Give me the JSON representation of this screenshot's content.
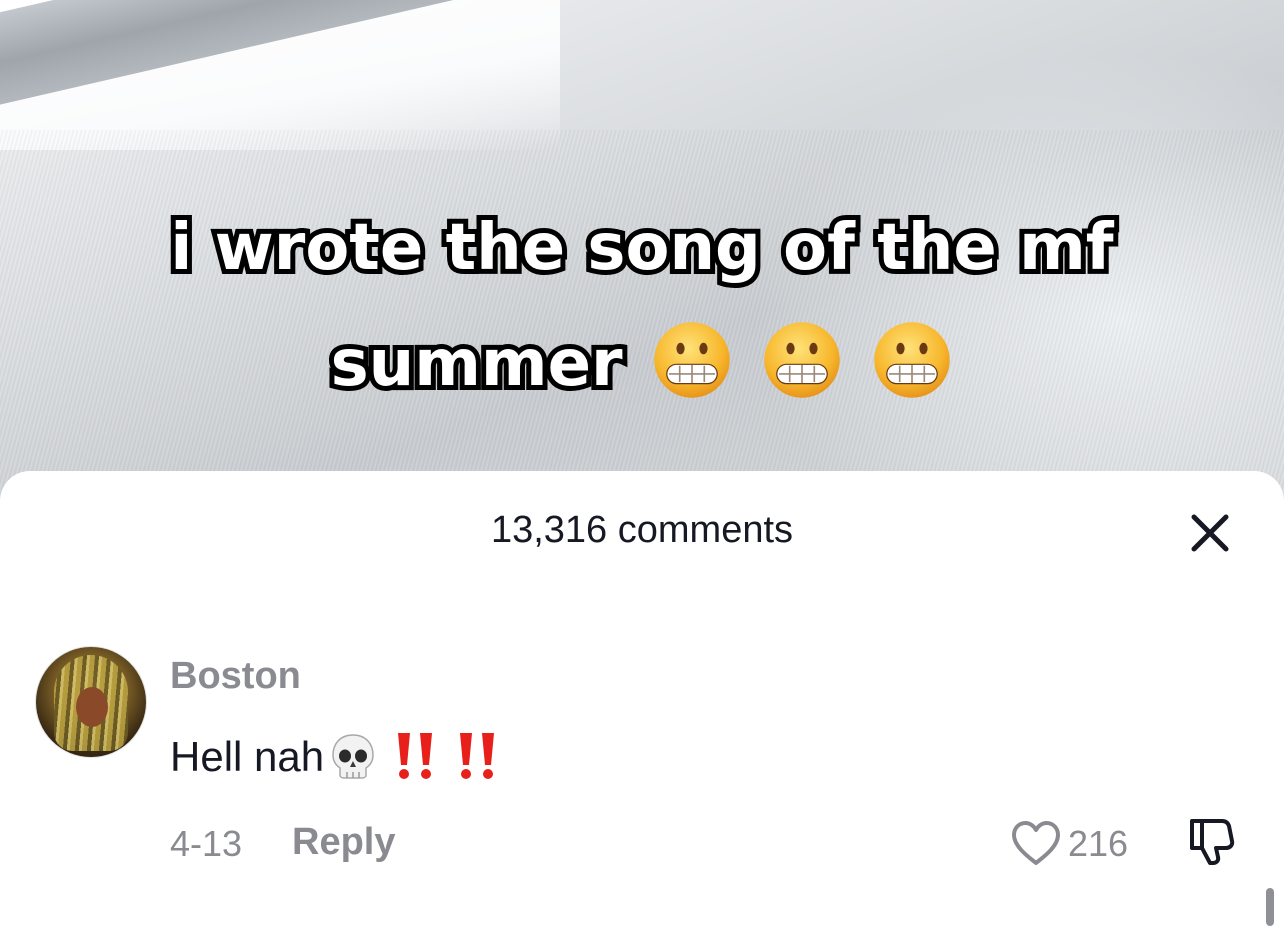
{
  "video": {
    "caption_line1": "i wrote the song of the mf",
    "caption_line2": "summer",
    "caption_emojis": [
      "grimacing-face",
      "grimacing-face",
      "grimacing-face"
    ]
  },
  "comments_panel": {
    "title": "13,316 comments",
    "close_icon": "close-icon"
  },
  "comment": {
    "username": "Boston",
    "text": "Hell nah",
    "text_emojis": [
      "skull",
      "double-exclamation",
      "double-exclamation"
    ],
    "date": "4-13",
    "reply_label": "Reply",
    "like_count": "216",
    "like_icon": "heart-outline-icon",
    "dislike_icon": "thumbs-down-icon"
  },
  "colors": {
    "primary_text": "#161823",
    "secondary_text": "#8a8b91",
    "exclamation_red": "#e8201c",
    "emoji_yellow": "#f7b72c"
  }
}
